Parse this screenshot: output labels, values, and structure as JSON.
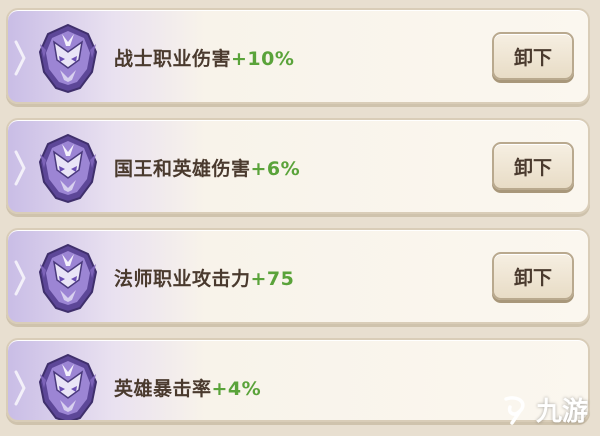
{
  "colors": {
    "bonus_green": "#5aa33a",
    "text_brown": "#4a3a2e",
    "card_bg": "#fbf7ef",
    "emblem_purple": "#7d63b8"
  },
  "skills": [
    {
      "name": "战士职业伤害",
      "bonus": "+10%",
      "button": "卸下",
      "icon": "purple-dragon-emblem-icon"
    },
    {
      "name": "国王和英雄伤害",
      "bonus": "+6%",
      "button": "卸下",
      "icon": "purple-dragon-emblem-icon"
    },
    {
      "name": "法师职业攻击力",
      "bonus": "+75",
      "button": "卸下",
      "icon": "purple-dragon-emblem-icon"
    },
    {
      "name": "英雄暴击率",
      "bonus": "+4%",
      "icon": "purple-dragon-emblem-icon"
    }
  ],
  "watermark": {
    "text": "九游",
    "icon": "jiuyou-logo-icon"
  }
}
